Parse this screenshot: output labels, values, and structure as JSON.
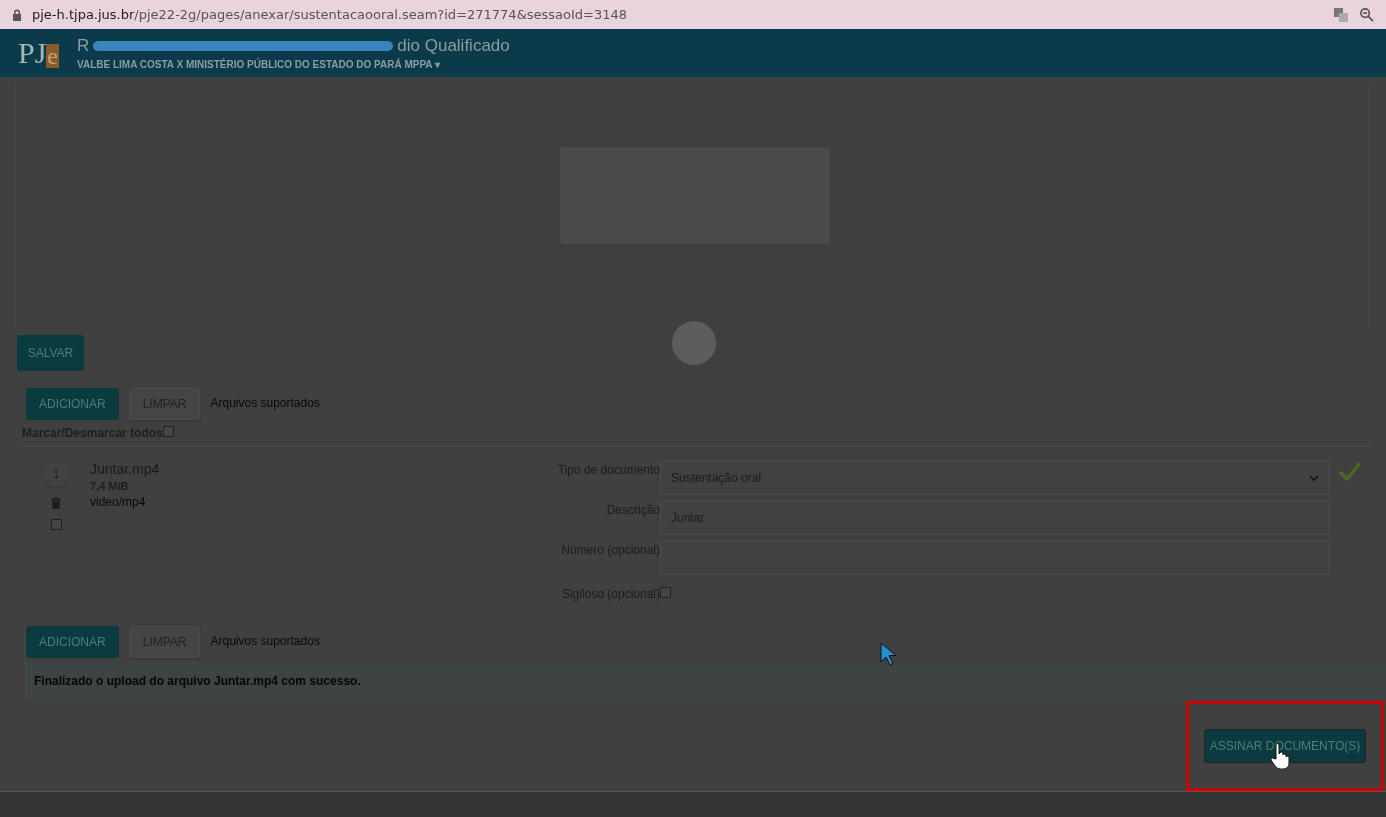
{
  "browser": {
    "url_host": "pje-h.tjpa.jus.br",
    "url_path": "/pje22-2g/pages/anexar/sustentacaooral.seam?id=271774&sessaoId=3148"
  },
  "header": {
    "logo": [
      "PJ",
      "e"
    ],
    "title_start": "R",
    "title_end": "dio Qualificado",
    "title_redacted": true,
    "subtitle": "VALBE LIMA COSTA X MINISTÉRIO PÚBLICO DO ESTADO DO PARÁ MPPA",
    "caret": "▾"
  },
  "loading": true,
  "save_button": "SALVAR",
  "upload_top": {
    "add_button": "ADICIONAR",
    "clear_button": "LIMPAR",
    "supported_link": "Arquivos suportados"
  },
  "select_all": {
    "label": "Marcar/Desmarcar todos",
    "checked": false
  },
  "files": [
    {
      "index": "1",
      "name": "Juntar.mp4",
      "size": "7,4 MiB",
      "mime": "video/mp4",
      "checked": false,
      "done": true,
      "fields": [
        {
          "kind": "select",
          "label": "Tipo de documento",
          "value": "Sustentação oral"
        },
        {
          "kind": "text",
          "label": "Descrição",
          "value": "Juntar"
        },
        {
          "kind": "text",
          "label": "Número (opcional)"
        },
        {
          "kind": "checkbox",
          "label": "Sigiloso (opcional)",
          "checked": false
        }
      ]
    }
  ],
  "upload_bottom": {
    "add_button": "ADICIONAR",
    "clear_button": "LIMPAR",
    "supported_link": "Arquivos suportados"
  },
  "message": "Finalizado o upload do arquivo Juntar.mp4 com sucesso.",
  "sign_button": {
    "label": "ASSINAR DOCUMENTO(S)",
    "highlighted": true
  }
}
